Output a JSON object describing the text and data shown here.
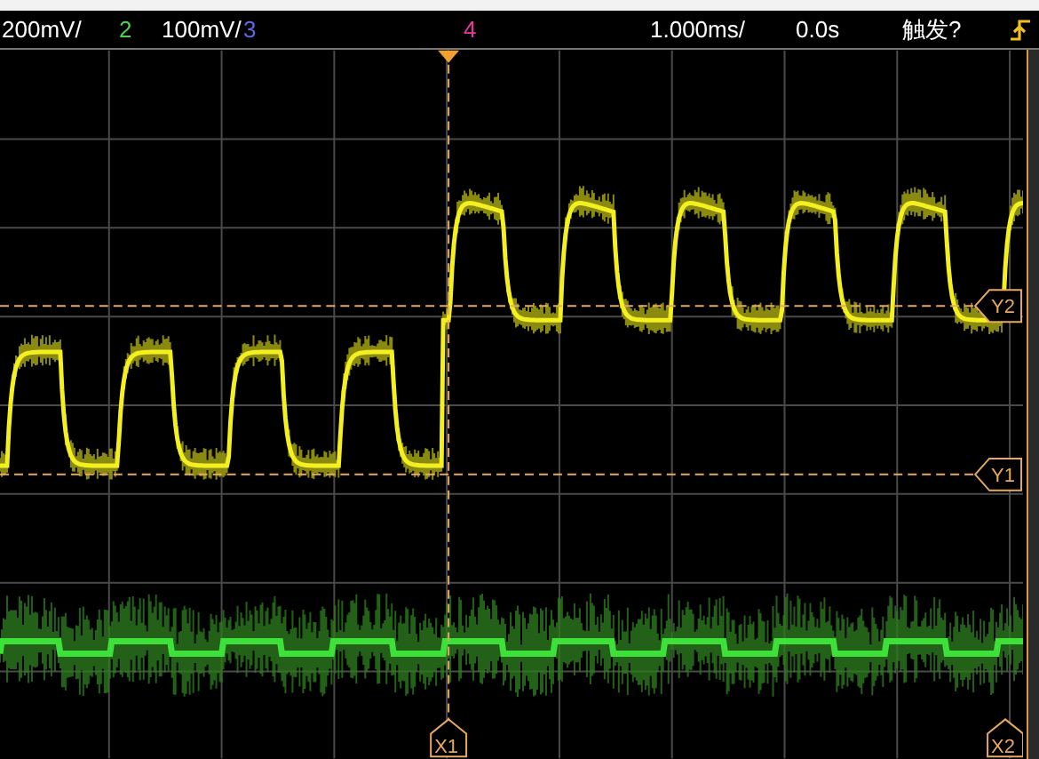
{
  "header": {
    "ch1_scale": "200mV/",
    "channels": [
      {
        "label": "2",
        "color": "#4cd44c",
        "scale": "100mV/"
      },
      {
        "label": "3",
        "color": "#5a6ae0"
      },
      {
        "label": "4",
        "color": "#e8389c"
      }
    ],
    "timebase": "1.000ms/",
    "delay": "0.0s",
    "trigger_status": "触发?"
  },
  "cursors": [
    {
      "label": "Y2",
      "kind": "horizontal"
    },
    {
      "label": "Y1",
      "kind": "horizontal"
    },
    {
      "label": "X1",
      "kind": "vertical"
    },
    {
      "label": "X2",
      "kind": "vertical"
    }
  ]
}
